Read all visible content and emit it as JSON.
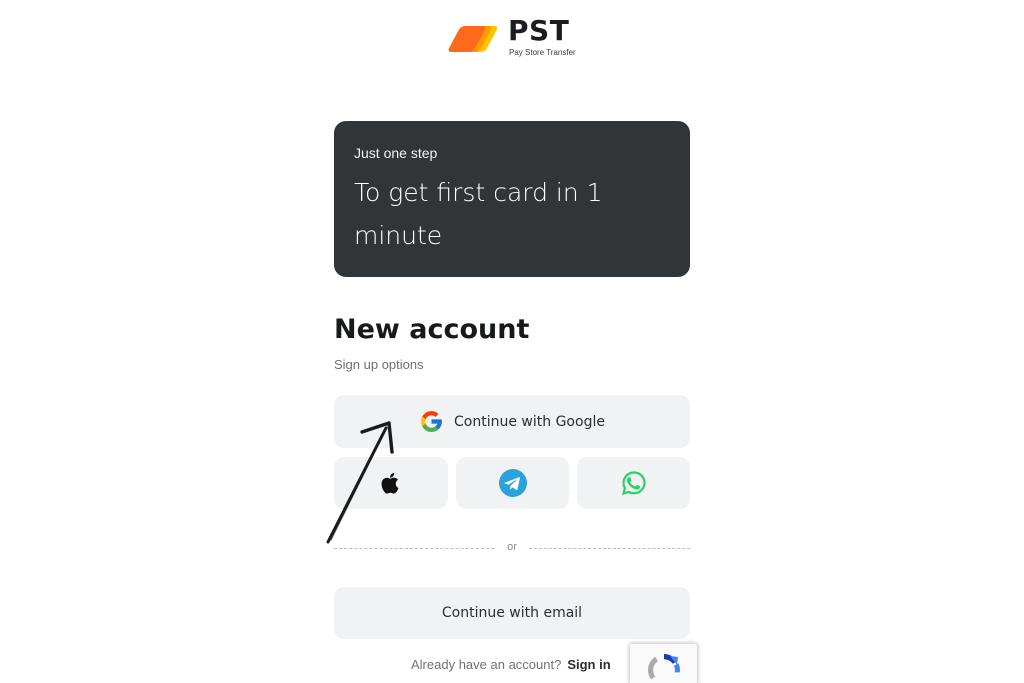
{
  "brand": {
    "name": "PST",
    "tagline": "Pay Store Transfer",
    "colors": [
      "#ff6a1a",
      "#ff9a00",
      "#ffc400"
    ]
  },
  "promo": {
    "kicker": "Just one step",
    "headline": "To get first card in 1 minute",
    "background": "#323538"
  },
  "signup": {
    "title": "New account",
    "subtitle": "Sign up options",
    "google_button": {
      "label": "Continue with Google",
      "icon": "google-icon"
    },
    "social_buttons": [
      {
        "icon": "apple-icon"
      },
      {
        "icon": "telegram-icon",
        "color": "#2aa3dd"
      },
      {
        "icon": "whatsapp-icon",
        "color": "#25d366"
      }
    ],
    "divider_text": "or",
    "email_button": {
      "label": "Continue with email"
    },
    "signin_prompt": "Already have an account?",
    "signin_link": "Sign in"
  },
  "recaptcha": {
    "icon": "recaptcha-icon"
  }
}
